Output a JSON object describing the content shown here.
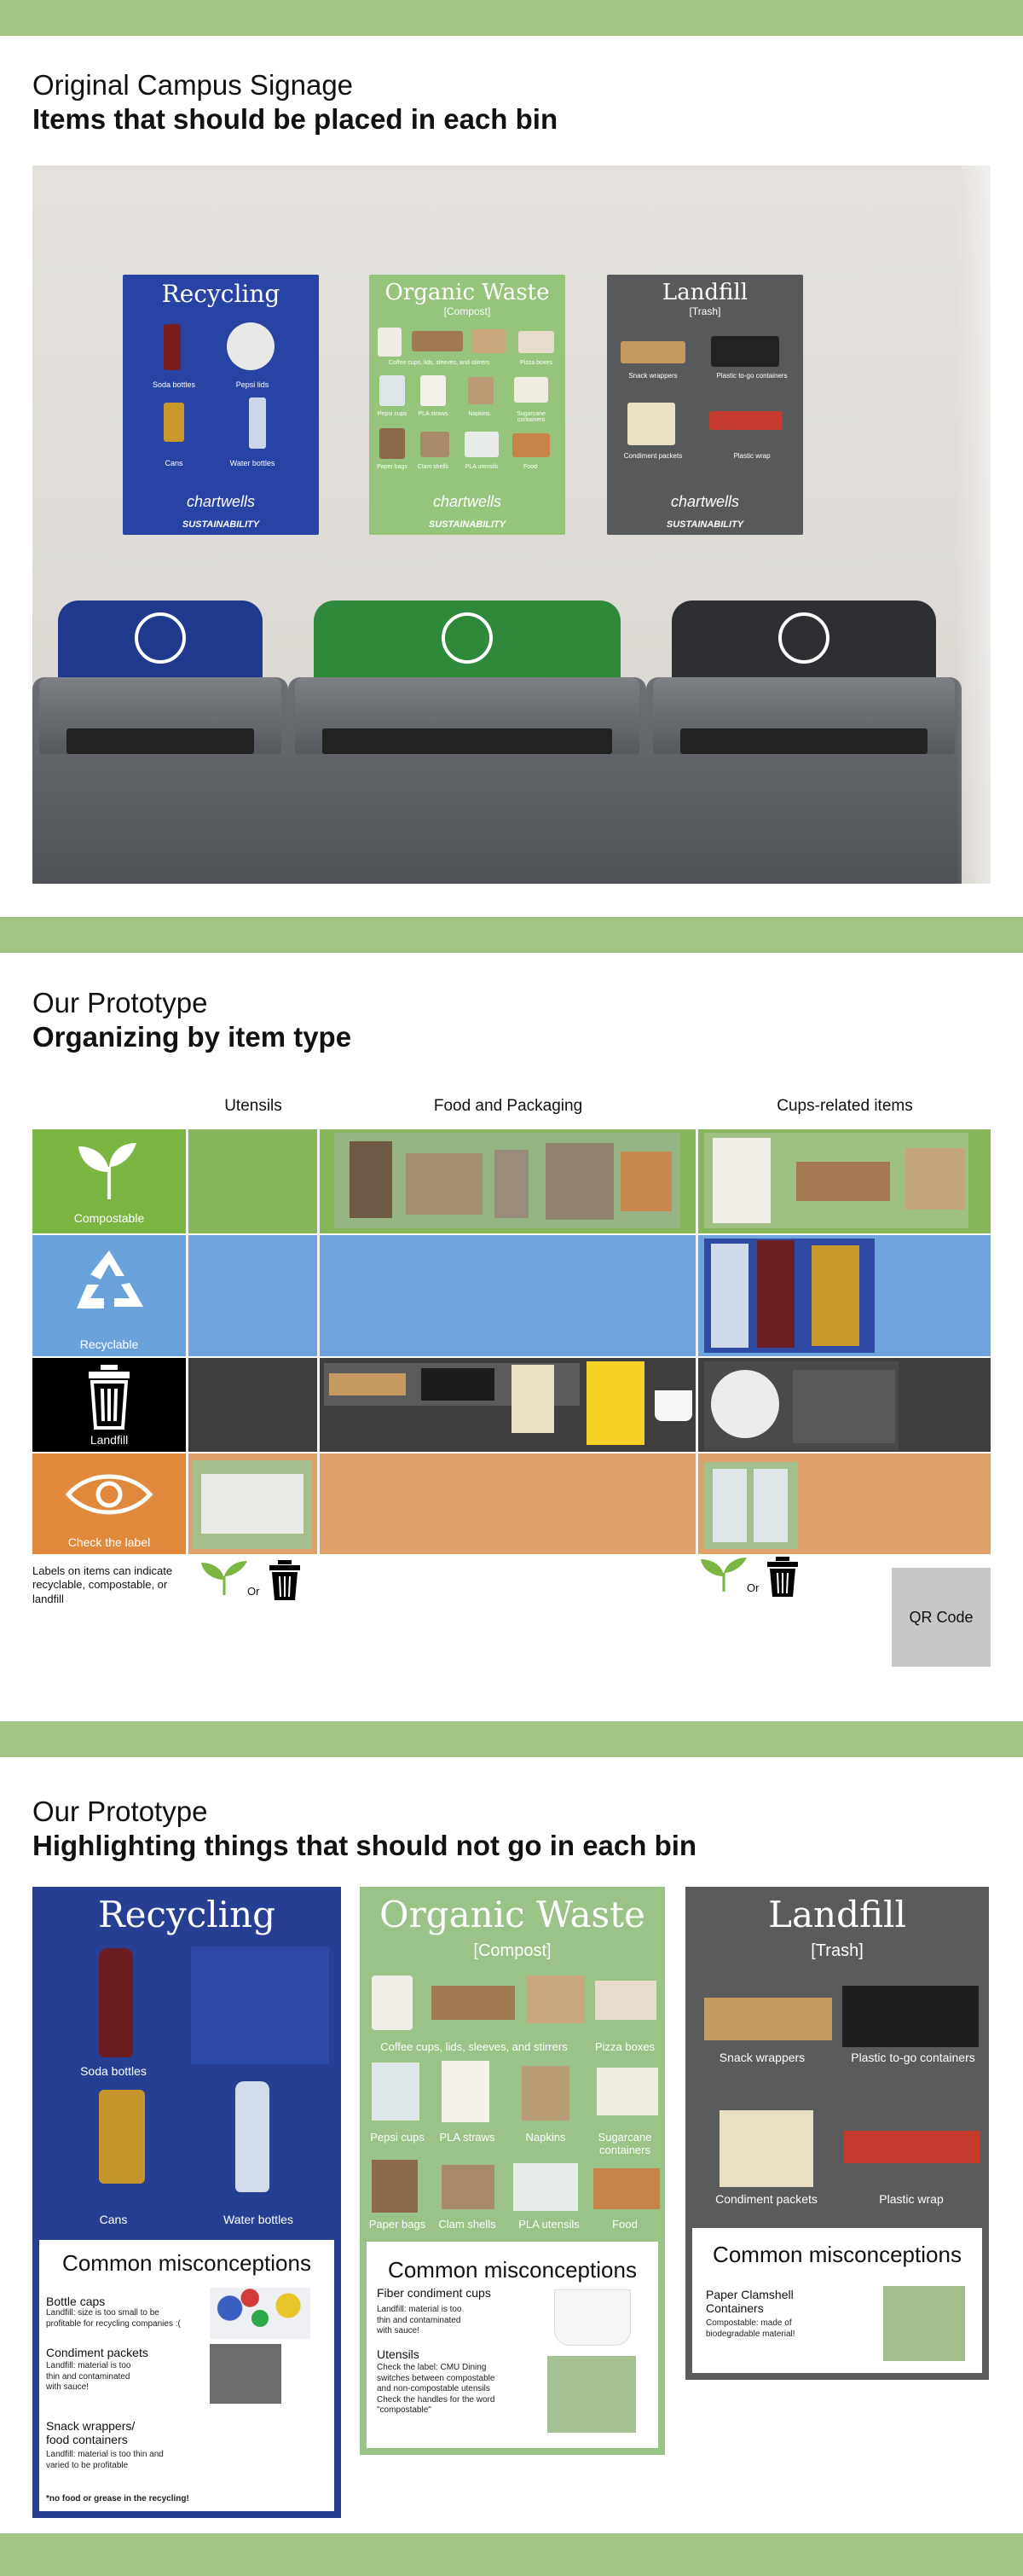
{
  "section1": {
    "title_line1": "Original Campus Signage",
    "title_line2": "Items that should be placed in each bin",
    "posters": [
      {
        "title": "Recycling",
        "subtitle": "",
        "items": [
          "Soda bottles",
          "Pepsi lids",
          "Cans",
          "Water bottles"
        ],
        "brand": "chartwells",
        "footer": "SUSTAINABILITY",
        "color": "#2743a3"
      },
      {
        "title": "Organic Waste",
        "subtitle": "[Compost]",
        "items": [
          "Coffee cups, lids, sleeves, and stirrers",
          "Pizza boxes",
          "Pepsi cups",
          "PLA straws",
          "Napkins",
          "Sugarcane containers",
          "Paper bags",
          "Clam shells",
          "PLA utensils",
          "Food"
        ],
        "brand": "chartwells",
        "footer": "SUSTAINABILITY",
        "color": "#96c47a"
      },
      {
        "title": "Landfill",
        "subtitle": "[Trash]",
        "items": [
          "Snack wrappers",
          "Plastic to-go containers",
          "Condiment packets",
          "Plastic wrap"
        ],
        "brand": "chartwells",
        "footer": "SUSTAINABILITY",
        "color": "#58595b"
      }
    ]
  },
  "section2": {
    "title_line1": "Our Prototype",
    "title_line2": "Organizing by item type",
    "columns": [
      "Utensils",
      "Food and Packaging",
      "Cups-related items"
    ],
    "rows": [
      {
        "label": "Compostable",
        "color": "#7ab641",
        "icon": "sprout-icon"
      },
      {
        "label": "Recyclable",
        "color": "#6aa2dc",
        "icon": "recycle-icon"
      },
      {
        "label": "Landfill",
        "color": "#000000",
        "icon": "trash-can-icon"
      },
      {
        "label": "Check the label",
        "color": "#e0893d",
        "icon": "eye-icon"
      }
    ],
    "note": "Labels on items can indicate recyclable, compostable, or landfill",
    "or_label": "Or",
    "qr_label": "QR Code"
  },
  "section3": {
    "title_line1": "Our Prototype",
    "title_line2": "Highlighting things that should not go in each bin",
    "misconceptions_heading": "Common misconceptions",
    "recycling": {
      "title": "Recycling",
      "captions": [
        "Soda bottles",
        "Cans",
        "Water bottles"
      ],
      "items": [
        {
          "name": "Bottle caps",
          "desc": "Landfill: size is too small to be profitable for recycling companies :("
        },
        {
          "name": "Condiment packets",
          "desc": "Landfill: material is too thin and contaminated with sauce!"
        },
        {
          "name": "Snack wrappers/ food containers",
          "desc": "Landfill: material is too thin and varied to be profitable"
        }
      ],
      "footnote": "*no food or grease in the recycling!"
    },
    "organic": {
      "title": "Organic Waste",
      "subtitle": "[Compost]",
      "captions": [
        "Coffee cups, lids, sleeves, and stirrers",
        "Pizza boxes",
        "Pepsi cups",
        "PLA straws",
        "Napkins",
        "Sugarcane containers",
        "Paper bags",
        "Clam shells",
        "PLA utensils",
        "Food"
      ],
      "items": [
        {
          "name": "Fiber condiment cups",
          "desc": "Landfill: material is too thin and contaminated with sauce!"
        },
        {
          "name": "Utensils",
          "desc": "Check the label: CMU Dining switches between compostable and non-compostable utensils Check the handles for the word \"compostable\""
        }
      ]
    },
    "landfill": {
      "title": "Landfill",
      "subtitle": "[Trash]",
      "captions": [
        "Snack wrappers",
        "Plastic to-go containers",
        "Condiment packets",
        "Plastic wrap"
      ],
      "items": [
        {
          "name": "Paper Clamshell Containers",
          "desc": "Compostable: made of biodegradable material!"
        }
      ]
    }
  }
}
